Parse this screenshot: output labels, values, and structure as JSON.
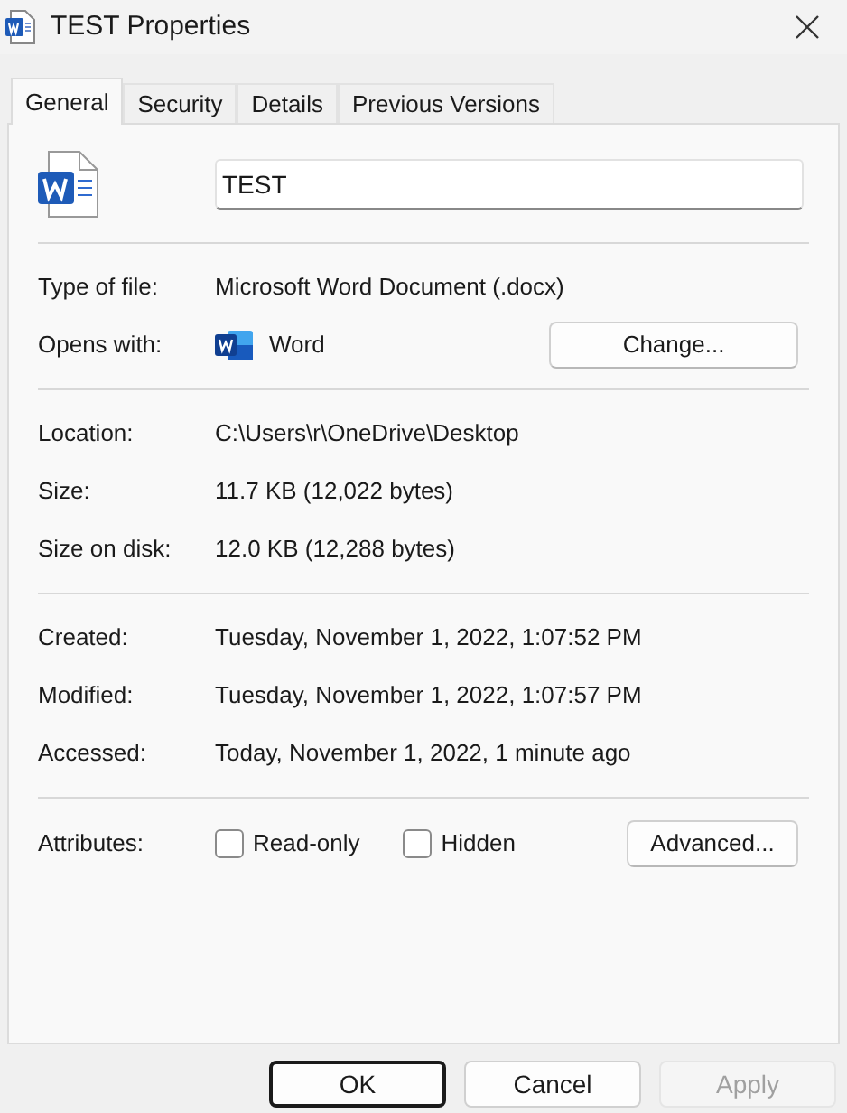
{
  "window": {
    "title": "TEST Properties"
  },
  "tabs": [
    {
      "label": "General",
      "selected": true
    },
    {
      "label": "Security",
      "selected": false
    },
    {
      "label": "Details",
      "selected": false
    },
    {
      "label": "Previous Versions",
      "selected": false
    }
  ],
  "file_name": {
    "value": "TEST"
  },
  "sections": [
    [
      {
        "label": "Type of file:",
        "value": "Microsoft Word Document (.docx)"
      },
      {
        "label": "Opens with:",
        "value": "Word",
        "app_icon": true,
        "button": "Change..."
      }
    ],
    [
      {
        "label": "Location:",
        "value": "C:\\Users\\r\\OneDrive\\Desktop"
      },
      {
        "label": "Size:",
        "value": "11.7 KB (12,022 bytes)"
      },
      {
        "label": "Size on disk:",
        "value": "12.0 KB (12,288 bytes)"
      }
    ],
    [
      {
        "label": "Created:",
        "value": "Tuesday, November 1, 2022, 1:07:52 PM"
      },
      {
        "label": "Modified:",
        "value": "Tuesday, November 1, 2022, 1:07:57 PM"
      },
      {
        "label": "Accessed:",
        "value": "Today, November 1, 2022, 1 minute ago"
      }
    ]
  ],
  "attributes": {
    "label": "Attributes:",
    "checkboxes": [
      {
        "label": "Read-only",
        "checked": false
      },
      {
        "label": "Hidden",
        "checked": false
      }
    ],
    "button": "Advanced..."
  },
  "buttons": [
    {
      "label": "OK",
      "default": true,
      "disabled": false
    },
    {
      "label": "Cancel",
      "default": false,
      "disabled": false
    },
    {
      "label": "Apply",
      "default": false,
      "disabled": true
    }
  ]
}
